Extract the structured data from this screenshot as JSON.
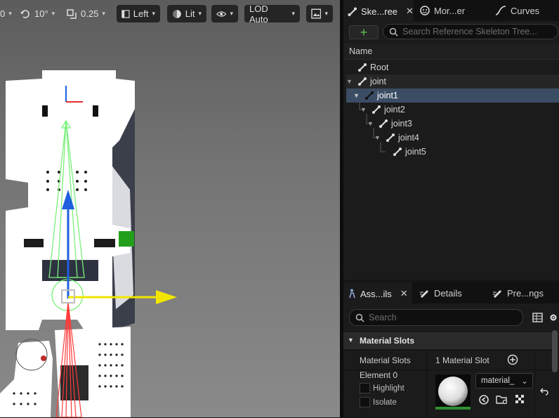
{
  "toolbar": {
    "rotation_prefix": "0",
    "rotation_snap": "10°",
    "scale_snap": "0.25",
    "view_mode": "Left",
    "lighting_mode": "Lit",
    "lod": "LOD Auto"
  },
  "skeleton_panel": {
    "tabs": [
      {
        "label": "Ske...ree"
      },
      {
        "label": "Mor...er"
      },
      {
        "label": "Curves"
      }
    ],
    "add_label": "+",
    "search_placeholder": "Search Reference Skeleton Tree...",
    "column_header": "Name",
    "bones": [
      {
        "name": "Root",
        "depth": 0
      },
      {
        "name": "joint",
        "depth": 1
      },
      {
        "name": "joint1",
        "depth": 2,
        "selected": true
      },
      {
        "name": "joint2",
        "depth": 3
      },
      {
        "name": "joint3",
        "depth": 4
      },
      {
        "name": "joint4",
        "depth": 5
      },
      {
        "name": "joint5",
        "depth": 6
      }
    ]
  },
  "details_panel": {
    "tabs": [
      {
        "label": "Ass...ils"
      },
      {
        "label": "Details"
      },
      {
        "label": "Pre...ngs"
      }
    ],
    "search_placeholder": "Search",
    "section_title": "Material Slots",
    "material_slots_label": "Material Slots",
    "material_slots_value": "1 Material Slot",
    "element_label": "Element 0",
    "highlight_label": "Highlight",
    "isolate_label": "Isolate",
    "material_name": "material_"
  },
  "colors": {
    "accent_green": "#5dc34e",
    "selection": "#3b4d64",
    "gizmo_z": "#1f5fe0",
    "gizmo_y": "#f2e600",
    "gizmo_x": "#22a01b"
  }
}
